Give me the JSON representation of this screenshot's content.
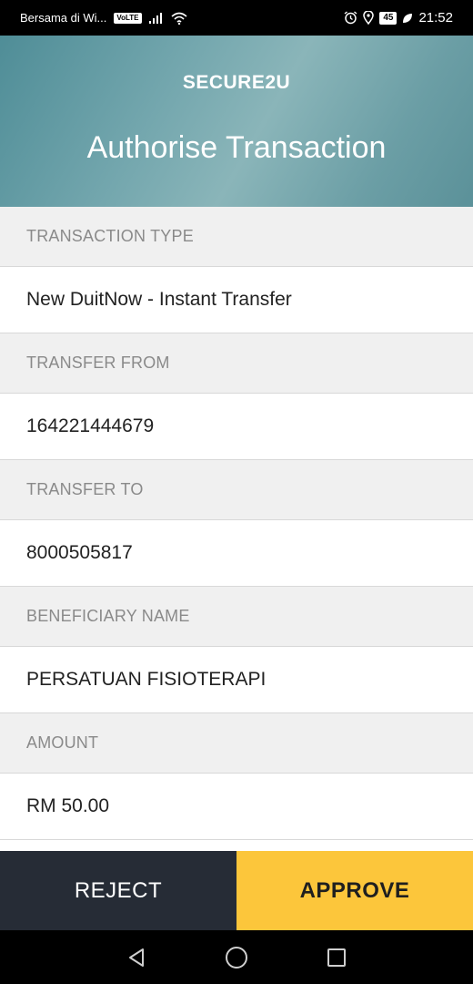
{
  "status_bar": {
    "carrier": "Bersama di Wi...",
    "volte": "VoLTE",
    "battery": "45",
    "time": "21:52"
  },
  "header": {
    "brand": "SECURE2U",
    "title": "Authorise Transaction"
  },
  "details": [
    {
      "label": "TRANSACTION TYPE",
      "value": "New DuitNow - Instant Transfer"
    },
    {
      "label": "TRANSFER FROM",
      "value": "164221444679"
    },
    {
      "label": "TRANSFER TO",
      "value": "8000505817"
    },
    {
      "label": "BENEFICIARY NAME",
      "value": "PERSATUAN FISIOTERAPI"
    },
    {
      "label": "AMOUNT",
      "value": "RM 50.00"
    }
  ],
  "actions": {
    "reject_label": "REJECT",
    "approve_label": "APPROVE"
  },
  "colors": {
    "reject_bg": "#262c36",
    "approve_bg": "#fcc63b",
    "header_teal": "#5b9199"
  },
  "icons": {
    "status": [
      "signal-icon",
      "wifi-icon",
      "alarm-icon",
      "location-icon",
      "battery-icon",
      "leaf-icon"
    ],
    "nav": [
      "back-icon",
      "home-icon",
      "recents-icon"
    ]
  }
}
